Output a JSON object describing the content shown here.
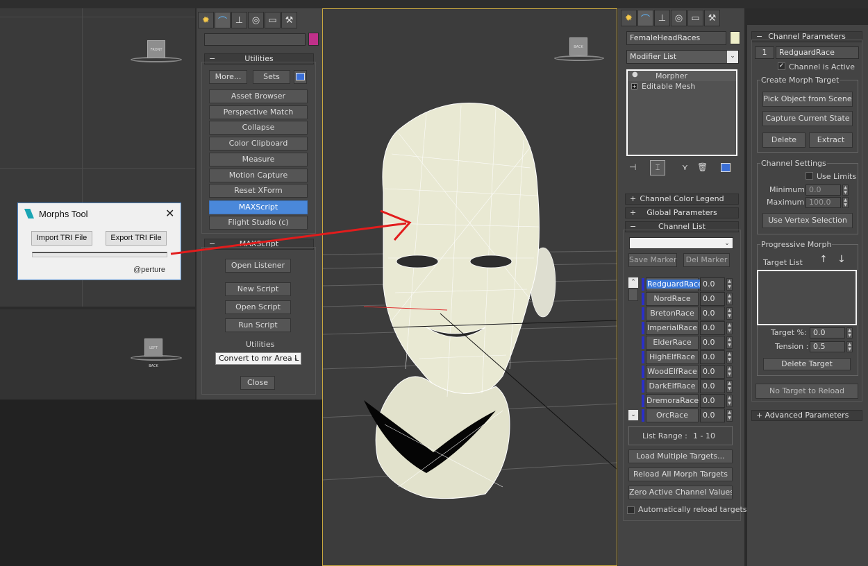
{
  "viewports": {
    "front_cube": "FRONT",
    "back_cube": "BACK",
    "left_cube": "LEFT BACK",
    "persp_cube": "BACK"
  },
  "utilities_panel": {
    "tabs": [
      "sun-icon",
      "curve-icon",
      "hierarchy-icon",
      "motion-icon",
      "display-icon",
      "hammer-icon"
    ],
    "name_field": "",
    "color_swatch": "#c0308a",
    "rollout_title": "Utilities",
    "more_button": "More...",
    "sets_button": "Sets",
    "tools": [
      "Asset Browser",
      "Perspective Match",
      "Collapse",
      "Color Clipboard",
      "Measure",
      "Motion Capture",
      "Reset XForm",
      "MAXScript",
      "Flight Studio (c)"
    ],
    "active_tool": "MAXScript",
    "maxscript_rollout": "MAXScript",
    "open_listener": "Open Listener",
    "new_script": "New Script",
    "open_script": "Open Script",
    "run_script": "Run Script",
    "utilities_label": "Utilities",
    "utilities_select": "Convert to mr Area L",
    "close_button": "Close"
  },
  "morphs_dialog": {
    "title": "Morphs Tool",
    "import_button": "Import TRI File",
    "export_button": "Export TRI File",
    "credit": "@perture"
  },
  "modify_panel": {
    "tabs": [
      "sun-icon",
      "curve-icon",
      "hierarchy-icon",
      "motion-icon",
      "display-icon",
      "hammer-icon"
    ],
    "object_name": "FemaleHeadRaces",
    "modifier_list": "Modifier List",
    "stack": [
      "Morpher",
      "Editable Mesh"
    ],
    "rollouts": {
      "color_legend": "Channel Color Legend",
      "global_params": "Global Parameters",
      "channel_list": "Channel List"
    },
    "save_marker": "Save Marker",
    "del_marker": "Del Marker",
    "channels": [
      {
        "name": "RedguardRace",
        "value": "0.0"
      },
      {
        "name": "NordRace",
        "value": "0.0"
      },
      {
        "name": "BretonRace",
        "value": "0.0"
      },
      {
        "name": "ImperialRace",
        "value": "0.0"
      },
      {
        "name": "ElderRace",
        "value": "0.0"
      },
      {
        "name": "HighElfRace",
        "value": "0.0"
      },
      {
        "name": "WoodElfRace",
        "value": "0.0"
      },
      {
        "name": "DarkElfRace",
        "value": "0.0"
      },
      {
        "name": "DremoraRace",
        "value": "0.0"
      },
      {
        "name": "OrcRace",
        "value": "0.0"
      }
    ],
    "list_range_label": "List Range :",
    "list_range_value": "1 - 10",
    "load_multiple": "Load Multiple Targets...",
    "reload_all": "Reload All Morph Targets",
    "zero_active": "Zero Active Channel Values",
    "auto_reload": "Automatically reload targets"
  },
  "channel_params": {
    "rollout_title": "Channel Parameters",
    "channel_number": "1",
    "channel_name": "RedguardRace",
    "channel_active": "Channel is Active",
    "create_group": "Create Morph Target",
    "pick_object": "Pick Object from Scene",
    "capture_state": "Capture Current State",
    "delete_button": "Delete",
    "extract_button": "Extract",
    "settings_group": "Channel Settings",
    "use_limits": "Use Limits",
    "minimum_label": "Minimum :",
    "minimum_value": "0.0",
    "maximum_label": "Maximum :",
    "maximum_value": "100.0",
    "use_vertex_selection": "Use Vertex Selection",
    "progressive_group": "Progressive Morph",
    "target_list_label": "Target List",
    "target_pct_label": "Target %:",
    "target_pct_value": "0.0",
    "tension_label": "Tension :",
    "tension_value": "0.5",
    "delete_target": "Delete Target",
    "no_target": "No Target to Reload",
    "advanced_rollout": "Advanced Parameters"
  }
}
